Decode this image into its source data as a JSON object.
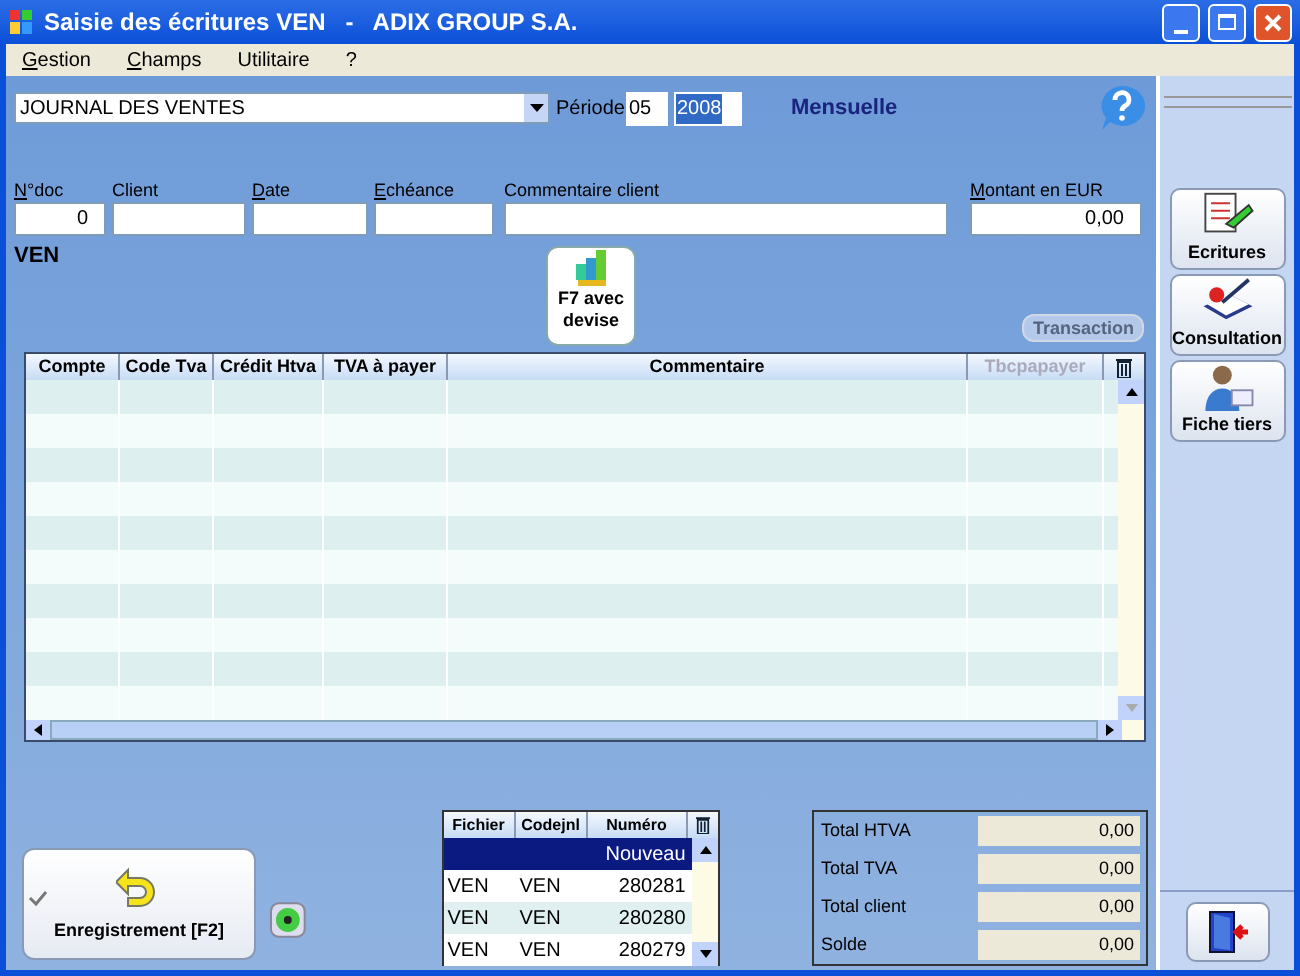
{
  "window": {
    "title": "Saisie des écritures VEN   -   ADIX GROUP S.A."
  },
  "menu": [
    {
      "label": "Gestion",
      "mnemonic": true
    },
    {
      "label": "Champs",
      "mnemonic": true
    },
    {
      "label": "Utilitaire",
      "mnemonic": false
    },
    {
      "label": "?",
      "mnemonic": false
    }
  ],
  "journal": {
    "value": "JOURNAL DES VENTES"
  },
  "periode": {
    "label": "Période",
    "month": "05",
    "year": "2008",
    "year_selected": true
  },
  "frequency": "Mensuelle",
  "fields": [
    {
      "label": "N°doc",
      "mnemonic": true,
      "value": "0",
      "kind": "number"
    },
    {
      "label": "Client",
      "mnemonic": false,
      "kind": "text"
    },
    {
      "label": "Date",
      "mnemonic": true,
      "kind": "text"
    },
    {
      "label": "Echéance",
      "mnemonic": true,
      "kind": "text"
    },
    {
      "label": "Commentaire client",
      "mnemonic": false,
      "kind": "text"
    },
    {
      "label": "Montant en EUR",
      "mnemonic": true,
      "value": "0,00",
      "kind": "number"
    }
  ],
  "journal_code": "VEN",
  "devise_button": {
    "label": "F7 avec devise"
  },
  "transaction_button": {
    "label": "Transaction",
    "disabled": true
  },
  "table": {
    "columns": [
      {
        "label": "Compte",
        "disabled": false
      },
      {
        "label": "Code Tva",
        "disabled": false
      },
      {
        "label": "Crédit Htva",
        "disabled": false
      },
      {
        "label": "TVA à payer",
        "disabled": false
      },
      {
        "label": "Commentaire",
        "disabled": false
      },
      {
        "label": "Tbcpapayer",
        "disabled": true
      }
    ]
  },
  "side_buttons": [
    {
      "label": "Ecritures",
      "kind": "ecritures"
    },
    {
      "label": "Consultation",
      "kind": "consultation"
    },
    {
      "label": "Fiche tiers",
      "kind": "tiers"
    }
  ],
  "save_button": {
    "label": "Enregistrement [F2]"
  },
  "documents": {
    "columns": [
      "Fichier",
      "Codejnl",
      "Numéro"
    ],
    "rows": [
      {
        "fichier": "",
        "codejnl": "",
        "numero": "Nouveau",
        "selected": true
      },
      {
        "fichier": "VEN",
        "codejnl": "VEN",
        "numero": "280281",
        "selected": false
      },
      {
        "fichier": "VEN",
        "codejnl": "VEN",
        "numero": "280280",
        "selected": false
      },
      {
        "fichier": "VEN",
        "codejnl": "VEN",
        "numero": "280279",
        "selected": false
      }
    ]
  },
  "totals": [
    {
      "label": "Total HTVA",
      "value": "0,00"
    },
    {
      "label": "Total TVA",
      "value": "0,00"
    },
    {
      "label": "Total client",
      "value": "0,00"
    },
    {
      "label": "Solde",
      "value": "0,00"
    }
  ]
}
